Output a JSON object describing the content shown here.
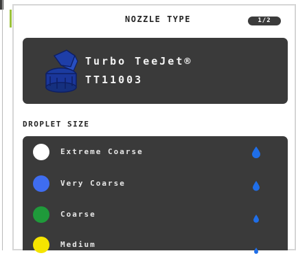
{
  "header": {
    "title": "NOZZLE TYPE",
    "page_indicator": "1/2"
  },
  "nozzle": {
    "name": "Turbo TeeJet®",
    "code": "TT11003",
    "icon": "nozzle-icon"
  },
  "droplet_section": {
    "label": "DROPLET SIZE",
    "items": [
      {
        "label": "Extreme Coarse",
        "color": "#ffffff",
        "icon": "water-drop-icon"
      },
      {
        "label": "Very Coarse",
        "color": "#3f6df0",
        "icon": "water-drop-icon"
      },
      {
        "label": "Coarse",
        "color": "#1f9a3a",
        "icon": "water-drop-icon"
      },
      {
        "label": "Medium",
        "color": "#f5e400",
        "icon": "water-drop-icon"
      }
    ]
  },
  "colors": {
    "panel": "#3a3a3a",
    "accent_drop": "#1f6ee8",
    "nozzle_blue": "#1e3ea8"
  }
}
